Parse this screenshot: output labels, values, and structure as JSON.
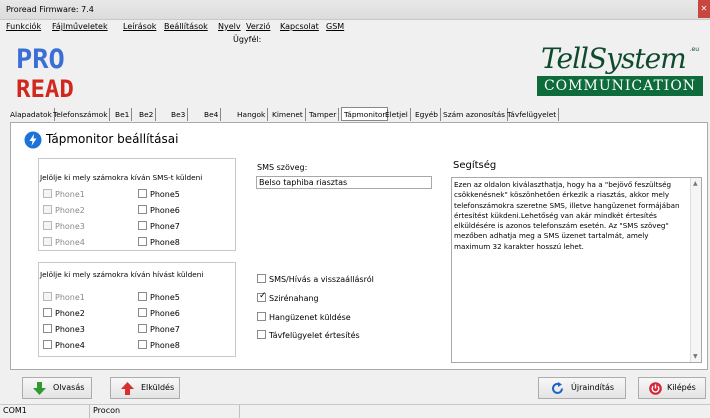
{
  "window": {
    "title": "Proread Firmware: 7.4"
  },
  "menu": [
    "Funkciók",
    "Fájlműveletek",
    "Leírások",
    "Beállítások",
    "Nyelv",
    "Verzió",
    "Kapcsolat",
    "GSM"
  ],
  "customer_label": "Ügyfél:",
  "logo": {
    "line1": "PRO",
    "line2": "READ"
  },
  "brand": {
    "name": "TellSystem",
    "sub": "COMMUNICATION",
    "tld": ".eu"
  },
  "tabs": [
    "Alapadatok",
    "Telefonszámok",
    "Be1",
    "Be2",
    "Be3",
    "Be4",
    "Hangok",
    "Kimenet",
    "Tamper",
    "Tápmonitor",
    "Életjel",
    "Egyéb",
    "Szám azonosítás",
    "Távfelügyelet"
  ],
  "active_tab": "Tápmonitor",
  "page_title": "Tápmonitor beállításai",
  "sms_group": {
    "label": "Jelölje ki mely számokra kíván SMS-t küldeni",
    "phones": [
      "Phone1",
      "Phone2",
      "Phone3",
      "Phone4",
      "Phone5",
      "Phone6",
      "Phone7",
      "Phone8"
    ]
  },
  "call_group": {
    "label": "Jelölje ki mely számokra kíván hívást küldeni",
    "phones": [
      "Phone1",
      "Phone2",
      "Phone3",
      "Phone4",
      "Phone5",
      "Phone6",
      "Phone7",
      "Phone8"
    ]
  },
  "sms_text": {
    "label": "SMS szöveg:",
    "value": "Belso taphiba riasztas"
  },
  "options": [
    {
      "label": "SMS/Hívás a visszaállásról",
      "checked": false
    },
    {
      "label": "Szirénahang",
      "checked": true
    },
    {
      "label": "Hangüzenet küldése",
      "checked": false
    },
    {
      "label": "Távfelügyelet értesítés",
      "checked": false
    }
  ],
  "help": {
    "title": "Segítség",
    "text": "Ezen az oldalon kiválaszthatja, hogy ha a \"bejövő feszültség csökkenésnek\" köszönhetően érkezik a riasztás, akkor mely telefonszámokra szeretne SMS, illetve hangüzenet formájában értesítést kükdeni.Lehetőség van akár mindkét értesítés elküldésére is azonos telefonszám esetén. Az \"SMS szöveg\" mezőben adhatja meg a SMS üzenet tartalmát, amely maximum 32 karakter hosszú lehet."
  },
  "buttons": {
    "read": "Olvasás",
    "send": "Elküldés",
    "restart": "Újraindítás",
    "exit": "Kilépés"
  },
  "status": {
    "port": "COM1",
    "device": "Procon"
  },
  "colors": {
    "brand_green": "#0d6b3c",
    "logo_blue": "#3a6fd8",
    "logo_red": "#d0281e",
    "accent": "#1e73d6"
  }
}
